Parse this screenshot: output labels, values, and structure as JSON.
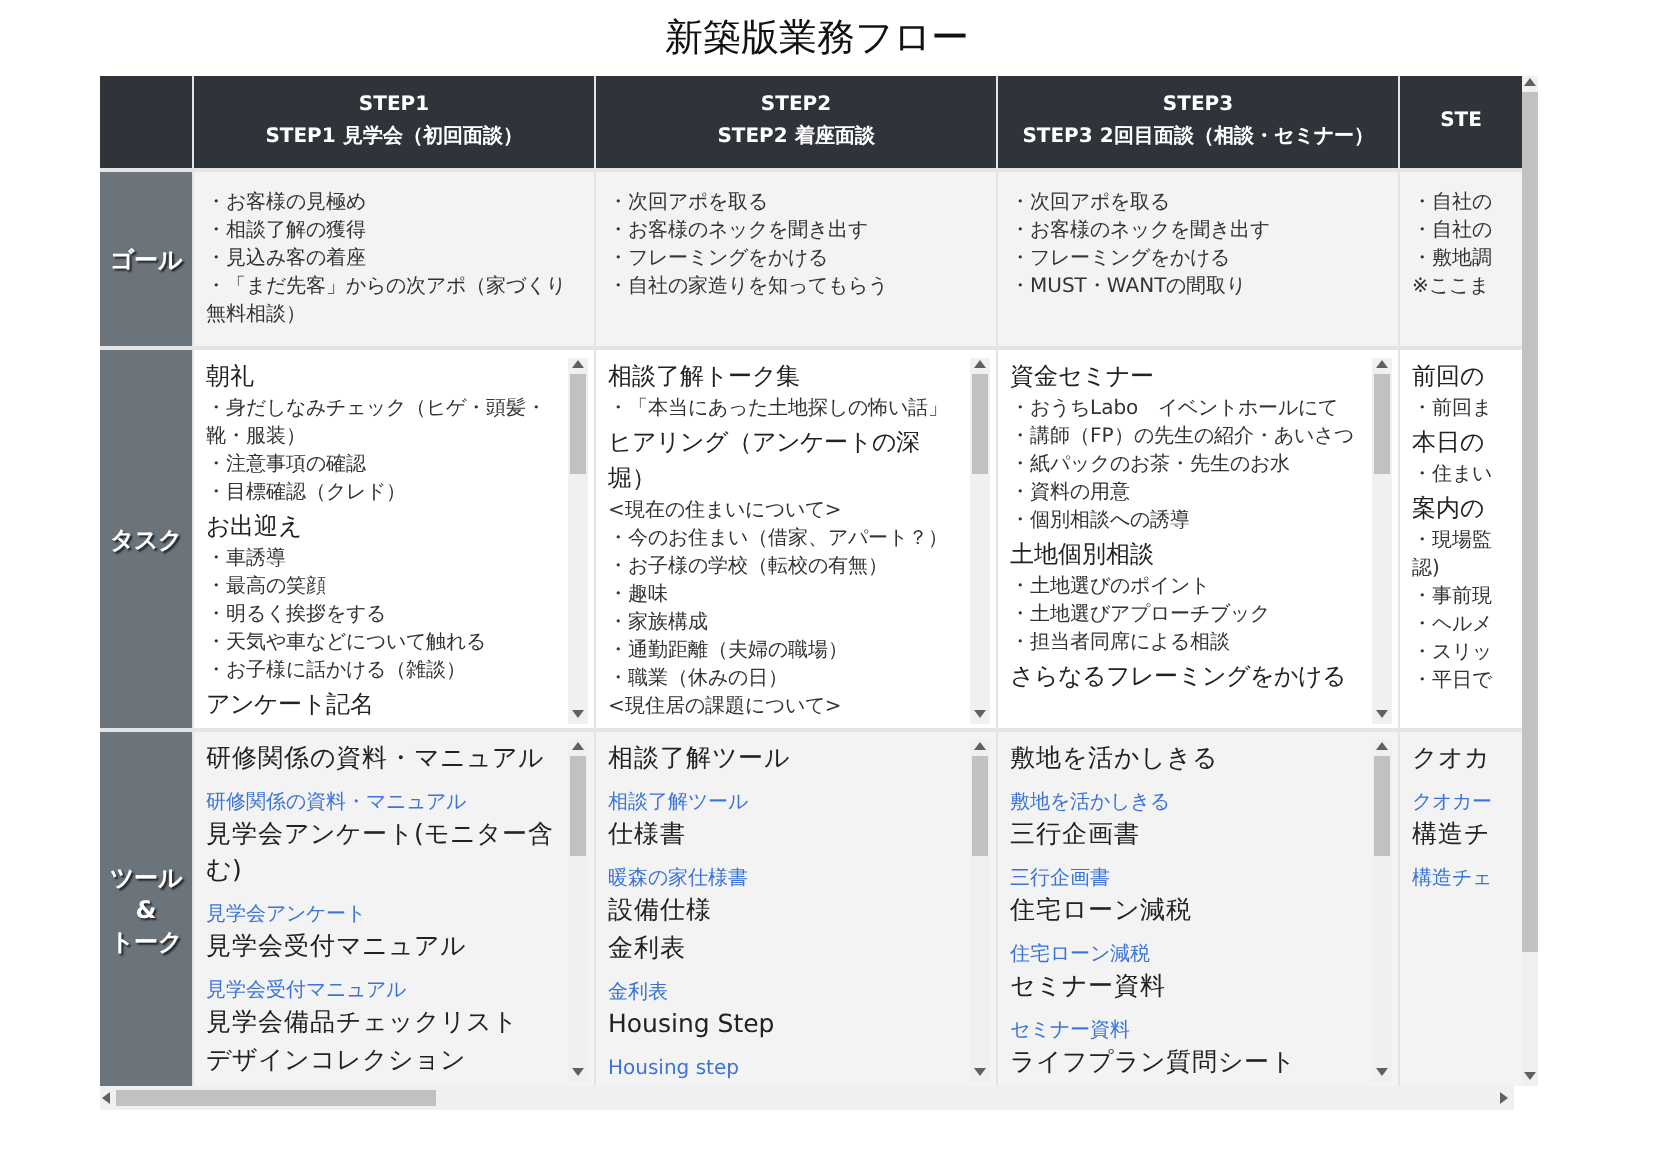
{
  "title": "新築版業務フロー",
  "columns": [
    {
      "step": "STEP1",
      "name": "STEP1 見学会（初回面談）",
      "cut": false
    },
    {
      "step": "STEP2",
      "name": "STEP2 着座面談",
      "cut": false
    },
    {
      "step": "STEP3",
      "name": "STEP3 2回目面談（相談・セミナー）",
      "cut": false
    },
    {
      "step": "STE",
      "cut": true
    }
  ],
  "rows": [
    {
      "label": [
        "ゴール"
      ],
      "kind": "goal",
      "cells": [
        {
          "lines": [
            {
              "kind": "item",
              "text": "・お客様の見極め"
            },
            {
              "kind": "item",
              "text": "・相談了解の獲得"
            },
            {
              "kind": "item",
              "text": "・見込み客の着座"
            },
            {
              "kind": "item",
              "text": "・「まだ先客」からの次アポ（家づくり無料相談）"
            }
          ]
        },
        {
          "lines": [
            {
              "kind": "item",
              "text": "・次回アポを取る"
            },
            {
              "kind": "item",
              "text": "・お客様のネックを聞き出す"
            },
            {
              "kind": "item",
              "text": "・フレーミングをかける"
            },
            {
              "kind": "item",
              "text": "・自社の家造りを知ってもらう"
            }
          ]
        },
        {
          "lines": [
            {
              "kind": "item",
              "text": "・次回アポを取る"
            },
            {
              "kind": "item",
              "text": "・お客様のネックを聞き出す"
            },
            {
              "kind": "item",
              "text": "・フレーミングをかける"
            },
            {
              "kind": "item",
              "text": "・MUST・WANTの間取り"
            }
          ]
        },
        {
          "lines": [
            {
              "kind": "item",
              "text": "・自社の"
            },
            {
              "kind": "item",
              "text": "・自社の"
            },
            {
              "kind": "item",
              "text": "・敷地調"
            },
            {
              "kind": "item",
              "text": "※ここま"
            }
          ]
        }
      ]
    },
    {
      "label": [
        "タスク"
      ],
      "kind": "task",
      "cells": [
        {
          "lines": [
            {
              "kind": "heading",
              "text": "朝礼"
            },
            {
              "kind": "item",
              "text": "・身だしなみチェック（ヒゲ・頭髪・靴・服装）"
            },
            {
              "kind": "item",
              "text": "・注意事項の確認"
            },
            {
              "kind": "item",
              "text": "・目標確認（クレド）"
            },
            {
              "kind": "heading",
              "text": "お出迎え"
            },
            {
              "kind": "item",
              "text": "・車誘導"
            },
            {
              "kind": "item",
              "text": "・最高の笑顔"
            },
            {
              "kind": "item",
              "text": "・明るく挨拶をする"
            },
            {
              "kind": "item",
              "text": "・天気や車などについて触れる"
            },
            {
              "kind": "item",
              "text": "・お子様に話かける（雑談）"
            },
            {
              "kind": "heading",
              "text": "アンケート記名"
            }
          ]
        },
        {
          "lines": [
            {
              "kind": "heading",
              "text": "相談了解トーク集"
            },
            {
              "kind": "item",
              "text": "・「本当にあった土地探しの怖い話」"
            },
            {
              "kind": "heading",
              "text": "ヒアリング（アンケートの深堀）"
            },
            {
              "kind": "item",
              "text": "<現在の住まいについて>"
            },
            {
              "kind": "item",
              "text": "・今のお住まい（借家、アパート？）"
            },
            {
              "kind": "item",
              "text": "・お子様の学校（転校の有無）"
            },
            {
              "kind": "item",
              "text": "・趣味"
            },
            {
              "kind": "item",
              "text": "・家族構成"
            },
            {
              "kind": "item",
              "text": "・通勤距離（夫婦の職場）"
            },
            {
              "kind": "item",
              "text": "・職業（休みの日）"
            },
            {
              "kind": "item",
              "text": "<現住居の課題について>"
            }
          ]
        },
        {
          "lines": [
            {
              "kind": "heading",
              "text": "資金セミナー"
            },
            {
              "kind": "item",
              "text": "・おうちLabo　イベントホールにて"
            },
            {
              "kind": "item",
              "text": "・講師（FP）の先生の紹介・あいさつ"
            },
            {
              "kind": "item",
              "text": "・紙パックのお茶・先生のお水"
            },
            {
              "kind": "item",
              "text": "・資料の用意"
            },
            {
              "kind": "item",
              "text": "・個別相談への誘導"
            },
            {
              "kind": "heading",
              "text": "土地個別相談"
            },
            {
              "kind": "item",
              "text": "・土地選びのポイント"
            },
            {
              "kind": "item",
              "text": "・土地選びアプローチブック"
            },
            {
              "kind": "item",
              "text": "・担当者同席による相談"
            },
            {
              "kind": "heading",
              "text": "さらなるフレーミングをかける"
            }
          ]
        },
        {
          "lines": [
            {
              "kind": "heading",
              "text": "前回の"
            },
            {
              "kind": "item",
              "text": "・前回ま"
            },
            {
              "kind": "heading",
              "text": "本日の"
            },
            {
              "kind": "item",
              "text": "・住まい"
            },
            {
              "kind": "heading",
              "text": "案内の"
            },
            {
              "kind": "item",
              "text": "・現場監"
            },
            {
              "kind": "item",
              "text": "認)"
            },
            {
              "kind": "item",
              "text": "・事前現"
            },
            {
              "kind": "item",
              "text": "・ヘルメ"
            },
            {
              "kind": "item",
              "text": "・スリッ"
            },
            {
              "kind": "item",
              "text": "・平日で"
            }
          ]
        }
      ]
    },
    {
      "label": [
        "ツール",
        "&",
        "トーク"
      ],
      "kind": "tools",
      "cells": [
        {
          "lines": [
            {
              "kind": "heading",
              "text": "研修関係の資料・マニュアル"
            },
            {
              "kind": "link",
              "text": "研修関係の資料・マニュアル"
            },
            {
              "kind": "heading",
              "text": "見学会アンケート(モニター含む)"
            },
            {
              "kind": "link",
              "text": "見学会アンケート"
            },
            {
              "kind": "heading",
              "text": "見学会受付マニュアル"
            },
            {
              "kind": "link",
              "text": "見学会受付マニュアル"
            },
            {
              "kind": "heading",
              "text": "見学会備品チェックリスト"
            },
            {
              "kind": "heading",
              "text": "デザインコレクション"
            }
          ]
        },
        {
          "lines": [
            {
              "kind": "heading",
              "text": "相談了解ツール"
            },
            {
              "kind": "link",
              "text": "相談了解ツール"
            },
            {
              "kind": "heading",
              "text": "仕様書"
            },
            {
              "kind": "link",
              "text": "暖森の家仕様書"
            },
            {
              "kind": "heading",
              "text": "設備仕様"
            },
            {
              "kind": "heading",
              "text": "金利表"
            },
            {
              "kind": "link",
              "text": "金利表"
            },
            {
              "kind": "heading",
              "text": "Housing Step"
            },
            {
              "kind": "link",
              "text": "Housing step"
            }
          ]
        },
        {
          "lines": [
            {
              "kind": "heading",
              "text": "敷地を活かしきる"
            },
            {
              "kind": "link",
              "text": "敷地を活かしきる"
            },
            {
              "kind": "heading",
              "text": "三行企画書"
            },
            {
              "kind": "link",
              "text": "三行企画書"
            },
            {
              "kind": "heading",
              "text": "住宅ローン減税"
            },
            {
              "kind": "link",
              "text": "住宅ローン減税"
            },
            {
              "kind": "heading",
              "text": "セミナー資料"
            },
            {
              "kind": "link",
              "text": "セミナー資料"
            },
            {
              "kind": "heading",
              "text": "ライフプラン質問シート"
            }
          ]
        },
        {
          "lines": [
            {
              "kind": "heading",
              "text": "クオカ"
            },
            {
              "kind": "link",
              "text": "クオカー"
            },
            {
              "kind": "heading",
              "text": "構造チ"
            },
            {
              "kind": "link",
              "text": "構造チェ"
            }
          ]
        }
      ]
    }
  ]
}
